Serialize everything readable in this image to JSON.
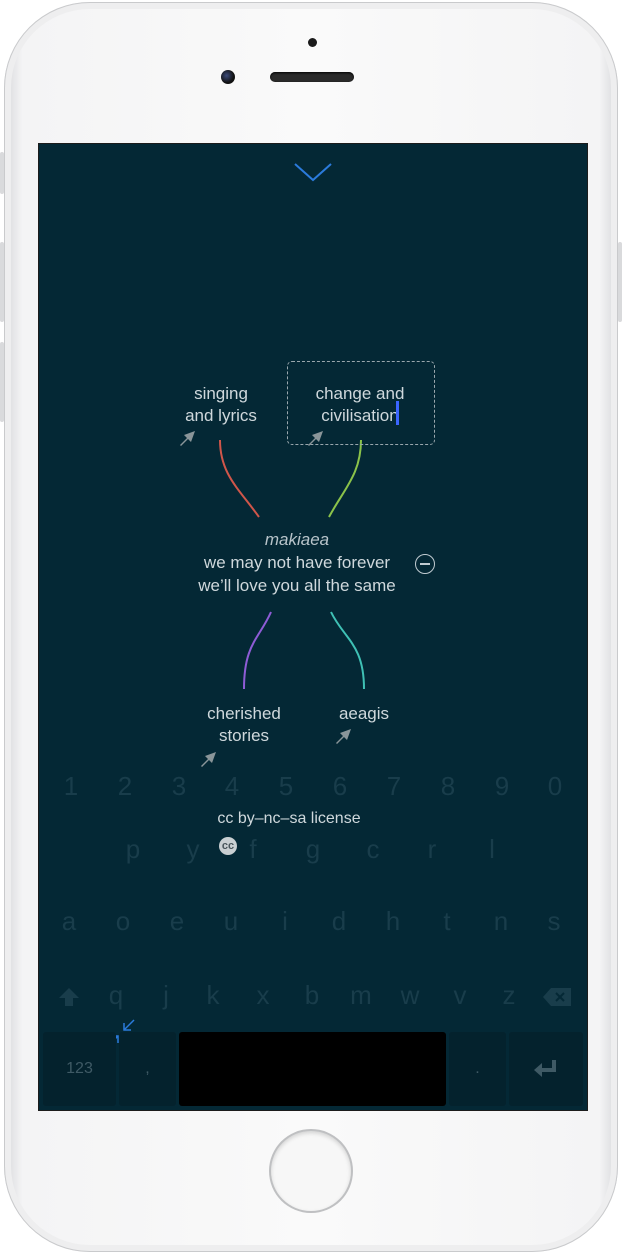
{
  "device": {
    "icons": [
      "camera-icon",
      "home-button"
    ]
  },
  "app": {
    "collapse_icon": "chevron-down-icon",
    "nodes": {
      "top_left": [
        "singing",
        "and lyrics"
      ],
      "top_right": [
        "change and",
        "civilisation"
      ],
      "bottom_left": [
        "cherished",
        "stories"
      ],
      "bottom_right": [
        "aeagis"
      ]
    },
    "center": {
      "title": "makiaea",
      "line1": "we may not have forever",
      "line2": "we’ll love you all the same"
    },
    "branch_colors": {
      "top_left": "#d0564a",
      "top_right": "#8bc34a",
      "bottom_left": "#8e5cd6",
      "bottom_right": "#3fc1b5"
    },
    "license": "cc by–nc–sa license",
    "license_icon": "cc-icon"
  },
  "keyboard": {
    "digits": [
      "1",
      "2",
      "3",
      "4",
      "5",
      "6",
      "7",
      "8",
      "9",
      "0"
    ],
    "row1": [
      "p",
      "y",
      "f",
      "g",
      "c",
      "r",
      "l"
    ],
    "row2": [
      "a",
      "o",
      "e",
      "u",
      "i",
      "d",
      "h",
      "t",
      "n",
      "s"
    ],
    "row3": [
      "q",
      "j",
      "k",
      "x",
      "b",
      "m",
      "w",
      "v",
      "z"
    ],
    "shift_icon": "shift-icon",
    "delete_icon": "backspace-icon",
    "numbers_label": "123",
    "comma_label": ",",
    "period_label": ".",
    "return_icon": "return-icon",
    "shrink_icon": "shrink-icon"
  }
}
